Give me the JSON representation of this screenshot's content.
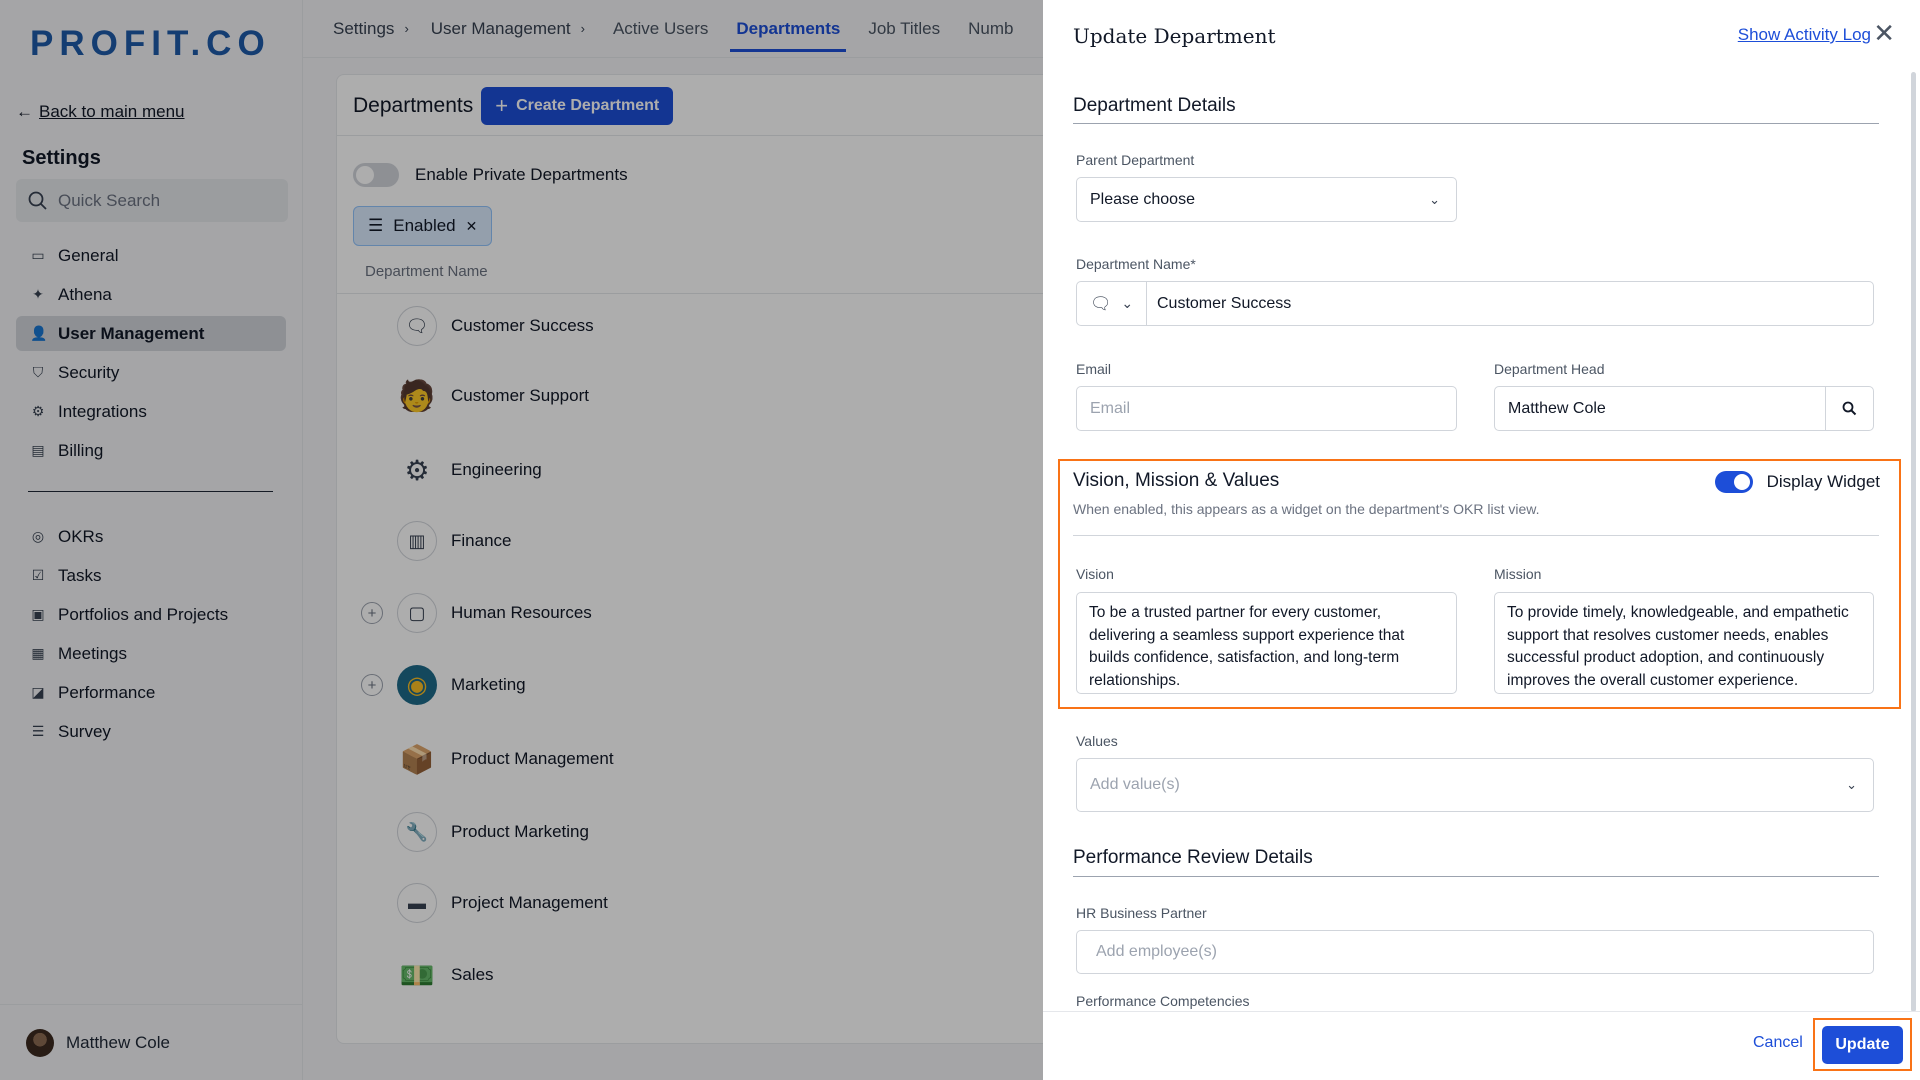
{
  "app": {
    "logo": "PROFIT.CO",
    "back_link": "Back to main menu",
    "settings_title": "Settings",
    "search_placeholder": "Quick Search",
    "nav_top": [
      {
        "label": "General",
        "icon": "monitor-icon"
      },
      {
        "label": "Athena",
        "icon": "sparkle-icon"
      },
      {
        "label": "User Management",
        "icon": "user-icon",
        "active": true
      },
      {
        "label": "Security",
        "icon": "shield-icon"
      },
      {
        "label": "Integrations",
        "icon": "gear-icon"
      },
      {
        "label": "Billing",
        "icon": "receipt-icon"
      }
    ],
    "nav_bottom": [
      {
        "label": "OKRs",
        "icon": "target-icon"
      },
      {
        "label": "Tasks",
        "icon": "checklist-icon"
      },
      {
        "label": "Portfolios and Projects",
        "icon": "briefcase-icon"
      },
      {
        "label": "Meetings",
        "icon": "calendar-icon"
      },
      {
        "label": "Performance",
        "icon": "chart-icon"
      },
      {
        "label": "Survey",
        "icon": "list-icon"
      }
    ],
    "user_name": "Matthew Cole"
  },
  "topbar": {
    "breadcrumbs": [
      "Settings",
      "User Management"
    ],
    "tabs": [
      "Active Users",
      "Departments",
      "Job Titles",
      "Numb"
    ],
    "active_tab": "Departments"
  },
  "departments": {
    "title": "Departments",
    "create_button": "Create Department",
    "private_toggle_label": "Enable Private Departments",
    "filter_chip": "Enabled",
    "column_header": "Department Name",
    "rows": [
      {
        "name": "Customer Success",
        "icon": "chat-icon",
        "expandable": false
      },
      {
        "name": "Customer Support",
        "icon": "support-agent-icon",
        "expandable": false
      },
      {
        "name": "Engineering",
        "icon": "engineering-icon",
        "expandable": false
      },
      {
        "name": "Finance",
        "icon": "bar-chart-icon",
        "expandable": false
      },
      {
        "name": "Human Resources",
        "icon": "id-badge-icon",
        "expandable": true
      },
      {
        "name": "Marketing",
        "icon": "globe-icon",
        "expandable": true
      },
      {
        "name": "Product Management",
        "icon": "product-box-icon",
        "expandable": false
      },
      {
        "name": "Product Marketing",
        "icon": "wrench-icon",
        "expandable": false
      },
      {
        "name": "Project Management",
        "icon": "bed-icon",
        "expandable": false
      },
      {
        "name": "Sales",
        "icon": "sales-hand-icon",
        "expandable": false
      }
    ]
  },
  "drawer": {
    "title": "Update Department",
    "activity_link": "Show Activity Log",
    "details_section": "Department Details",
    "parent_label": "Parent Department",
    "parent_value": "Please choose",
    "name_label": "Department Name*",
    "name_value": "Customer Success",
    "email_label": "Email",
    "email_placeholder": "Email",
    "head_label": "Department Head",
    "head_value": "Matthew Cole",
    "vmv_title": "Vision, Mission & Values",
    "vmv_description": "When enabled, this appears as a widget on the department's OKR list view.",
    "display_widget_label": "Display Widget",
    "display_widget_on": true,
    "vision_label": "Vision",
    "vision_text": "To be a trusted partner for every customer, delivering a seamless support experience that builds confidence, satisfaction, and long-term relationships.",
    "mission_label": "Mission",
    "mission_text": "To provide timely, knowledgeable, and empathetic support that resolves customer needs, enables successful product adoption, and continuously improves the overall customer experience.",
    "values_label": "Values",
    "values_placeholder": "Add value(s)",
    "performance_section": "Performance Review Details",
    "hr_partner_label": "HR Business Partner",
    "hr_partner_placeholder": "Add employee(s)",
    "competencies_label": "Performance Competencies",
    "cancel_button": "Cancel",
    "update_button": "Update"
  },
  "colors": {
    "primary": "#1d4ed8",
    "highlight": "#f97316"
  }
}
